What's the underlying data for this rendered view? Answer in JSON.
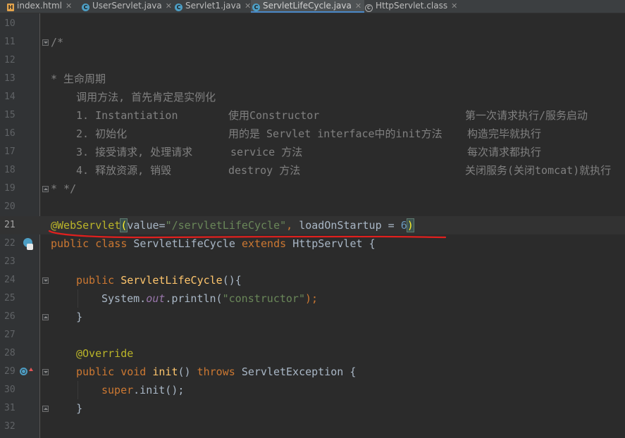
{
  "tabs": [
    {
      "label": "index.html",
      "icon": "html-file-icon",
      "active": false
    },
    {
      "label": "UserServlet.java",
      "icon": "java-class-icon",
      "active": false
    },
    {
      "label": "Servlet1.java",
      "icon": "java-class-icon",
      "active": false
    },
    {
      "label": "ServletLifeCycle.java",
      "icon": "java-class-icon",
      "active": true
    },
    {
      "label": "HttpServlet.class",
      "icon": "class-file-icon",
      "active": false
    }
  ],
  "tab_close_glyph": "✕",
  "icon_glyphs": {
    "html": "H",
    "java": "C",
    "class": "C"
  },
  "current_line": 21,
  "lines": [
    {
      "n": "10",
      "text": ""
    },
    {
      "n": "11",
      "text": "/*"
    },
    {
      "n": "12",
      "text": ""
    },
    {
      "n": "13",
      "text": "* 生命周期"
    },
    {
      "n": "14",
      "text": "    调用方法, 首先肯定是实例化"
    },
    {
      "n": "15",
      "text": "    1. Instantiation        使用Constructor                         第一次请求执行/服务启动"
    },
    {
      "n": "16",
      "text": "    2. 初始化               用的是 Servlet interface中的init方法     构造完毕就执行"
    },
    {
      "n": "17",
      "text": "    3. 接受请求, 处理请求       service 方法                            每次请求都执行"
    },
    {
      "n": "18",
      "text": "    4. 释放资源, 销毁          destroy 方法                            关闭服务(关闭tomcat)就执行"
    },
    {
      "n": "19",
      "text": "* */"
    },
    {
      "n": "20",
      "text": ""
    },
    {
      "n": "21",
      "text": "@WebServlet(value=\"/servletLifeCycle\", loadOnStartup = 6)"
    },
    {
      "n": "22",
      "text": "public class ServletLifeCycle extends HttpServlet {"
    },
    {
      "n": "23",
      "text": ""
    },
    {
      "n": "24",
      "text": "    public ServletLifeCycle(){"
    },
    {
      "n": "25",
      "text": "        System.out.println(\"constructor\");"
    },
    {
      "n": "26",
      "text": "    }"
    },
    {
      "n": "27",
      "text": ""
    },
    {
      "n": "28",
      "text": "    @Override"
    },
    {
      "n": "29",
      "text": "    public void init() throws ServletException {"
    },
    {
      "n": "30",
      "text": "        super.init();"
    },
    {
      "n": "31",
      "text": "    }"
    },
    {
      "n": "32",
      "text": ""
    }
  ],
  "comment_cols": {
    "l15": [
      "1. Instantiation",
      "使用Constructor",
      "第一次请求执行/服务启动"
    ],
    "l16": [
      "2. 初始化",
      "用的是 Servlet interface中的init方法",
      "构造完毕就执行"
    ],
    "l17": [
      "3. 接受请求, 处理请求",
      "service 方法",
      "每次请求都执行"
    ],
    "l18": [
      "4. 释放资源, 销毁",
      "destroy 方法",
      "关闭服务(关闭tomcat)就执行"
    ]
  },
  "tokens": {
    "l21": {
      "ann": "@WebServlet",
      "p1": "(",
      "k1": "value=",
      "s1": "\"/servletLifeCycle\"",
      "c1": ", ",
      "k2": "loadOnStartup = ",
      "n1": "6",
      "p2": ")"
    },
    "l22": {
      "k1": "public",
      "k2": "class",
      "name": "ServletLifeCycle",
      "k3": "extends",
      "sup": "HttpServlet",
      "b": "{"
    },
    "l24": {
      "k1": "public",
      "fn": "ServletLifeCycle",
      "rest": "(){"
    },
    "l25": {
      "a": "System.",
      "fld": "out",
      "b": ".println(",
      "s": "\"constructor\"",
      "c": ");"
    },
    "l28": {
      "ann": "@Override"
    },
    "l29": {
      "k1": "public",
      "k2": "void",
      "fn": "init",
      "p": "()",
      "k3": "throws",
      "ex": "ServletException {"
    },
    "l30": {
      "k": "super",
      "rest": ".init();"
    }
  },
  "colors": {
    "background": "#2b2b2b",
    "comment": "#808080",
    "keyword": "#cc7832",
    "annotation": "#bbb529",
    "string": "#6a8759",
    "number": "#6897bb",
    "function": "#ffc66d",
    "field": "#9876aa",
    "underline": "#e0201e"
  }
}
